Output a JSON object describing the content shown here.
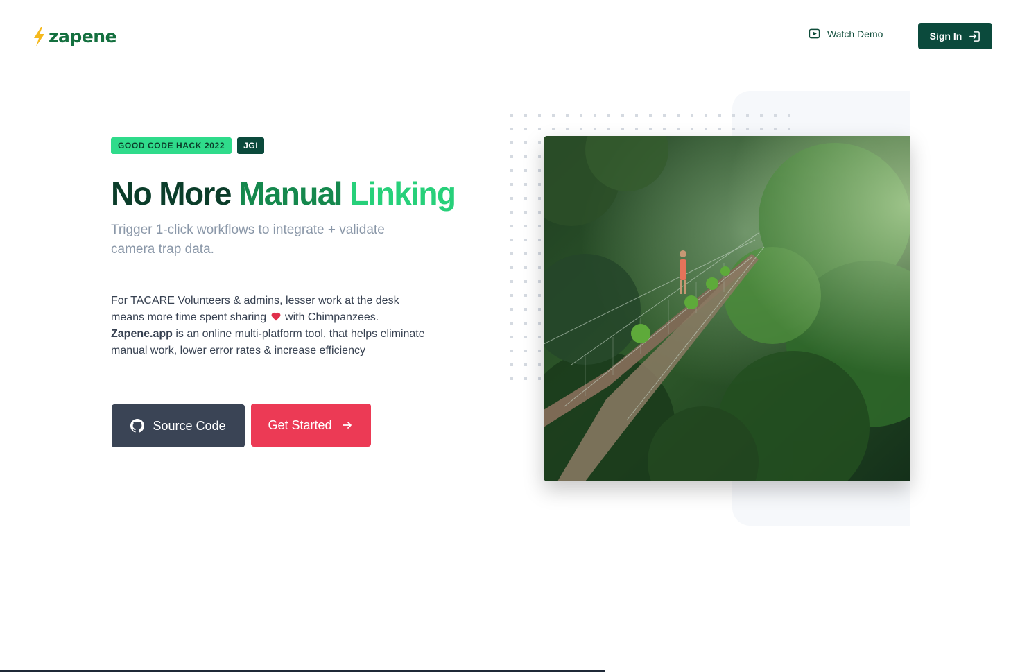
{
  "header": {
    "brand": "zapene",
    "watch_demo_label": "Watch Demo",
    "sign_in_label": "Sign In"
  },
  "hero": {
    "badges": [
      "GOOD CODE HACK 2022",
      "JGI"
    ],
    "title_part1": "No More",
    "title_part2": "Manual",
    "title_part3": "Linking",
    "subtitle": "Trigger 1-click workflows to integrate + validate camera trap data.",
    "desc_line1": "For TACARE Volunteers & admins, lesser work at the desk means more time spent sharing",
    "desc_line2": "with Chimpanzees.",
    "desc_brand": "Zapene.app",
    "desc_line3": "is an online multi-platform tool, that helps eliminate manual work, lower error rates & increase efficiency",
    "source_code_label": "Source Code",
    "get_started_label": "Get Started"
  },
  "icons": {
    "logo": "lightning-bolt-icon",
    "watch_demo": "play-video-icon",
    "sign_in": "sign-in-icon",
    "heart": "heart-icon",
    "source_code": "github-icon",
    "get_started": "arrow-right-icon"
  },
  "colors": {
    "brand_dark": "#0b4a3c",
    "brand_green": "#15884d",
    "accent_green": "#27d07a",
    "badge_green": "#2fdb8b",
    "cta_red": "#ec3a55",
    "slate_button": "#3a4455"
  }
}
